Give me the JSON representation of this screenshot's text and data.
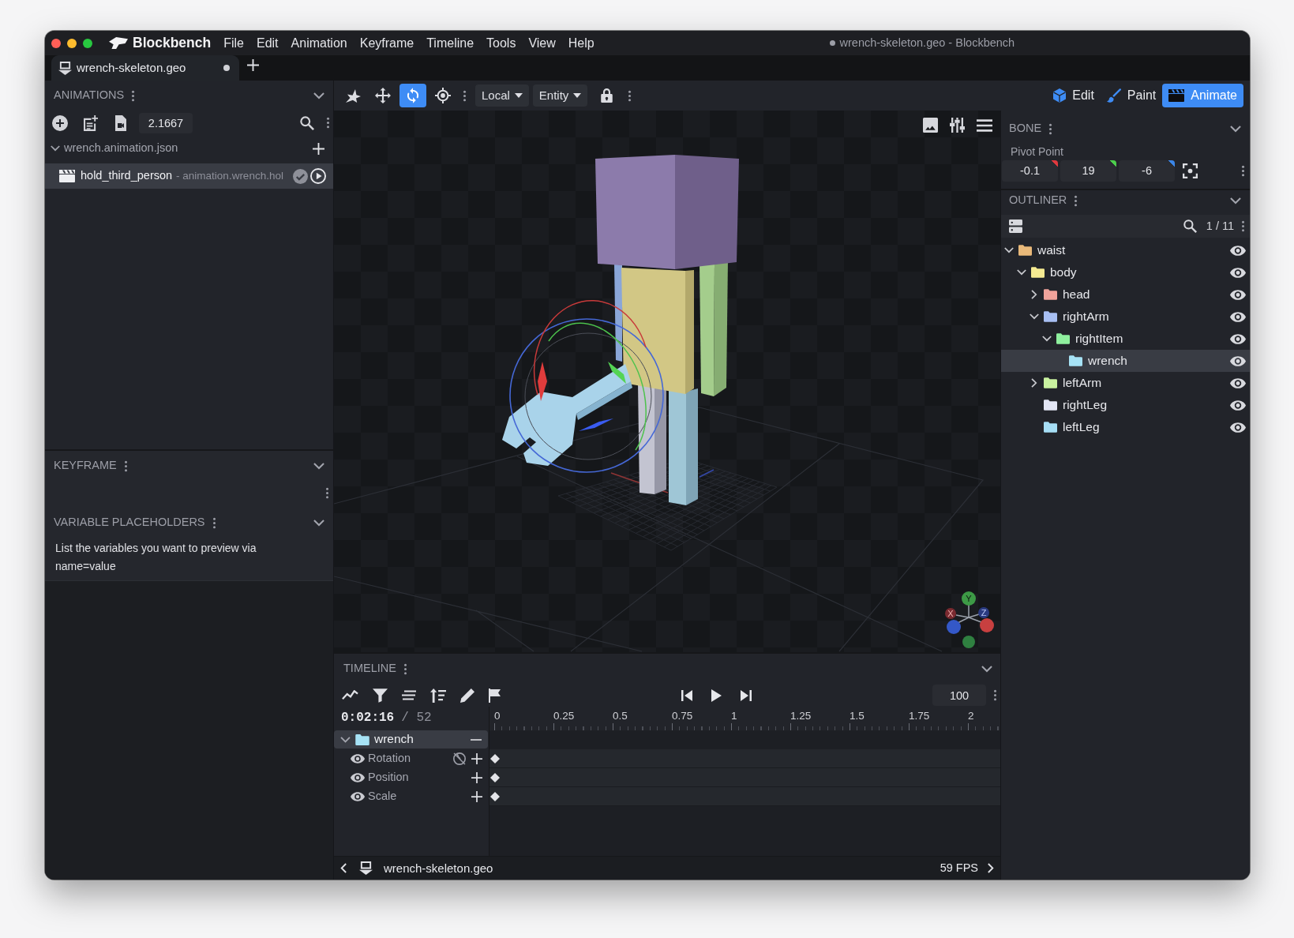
{
  "window": {
    "title": "wrench-skeleton.geo - Blockbench",
    "unsaved": true
  },
  "app_name": "Blockbench",
  "menu": [
    "File",
    "Edit",
    "Animation",
    "Keyframe",
    "Timeline",
    "Tools",
    "View",
    "Help"
  ],
  "tabs": [
    {
      "label": "wrench-skeleton.geo",
      "selected": true,
      "unsaved": true
    }
  ],
  "animations_panel": {
    "title": "ANIMATIONS",
    "value": "2.1667",
    "files": [
      {
        "name": "wrench.animation.json",
        "expanded": true,
        "animations": [
          {
            "name": "hold_third_person",
            "subtitle": "- animation.wrench.hol",
            "selected": true,
            "saved": true,
            "playing": false
          }
        ]
      }
    ]
  },
  "keyframe_panel": {
    "title": "KEYFRAME"
  },
  "variables_panel": {
    "title": "VARIABLE PLACEHOLDERS",
    "hint": "List the variables you want to preview via name=value"
  },
  "toolbar": {
    "tools": [
      {
        "kind": "pose",
        "selected": false
      },
      {
        "kind": "move",
        "selected": false
      },
      {
        "kind": "rotate",
        "selected": true
      },
      {
        "kind": "pivot",
        "selected": false
      }
    ],
    "space": "Local",
    "target": "Entity",
    "locked": true
  },
  "modes": [
    {
      "kind": "edit",
      "label": "Edit",
      "selected": false
    },
    {
      "kind": "paint",
      "label": "Paint",
      "selected": false
    },
    {
      "kind": "animate",
      "label": "Animate",
      "selected": true
    }
  ],
  "viewport": {
    "axis_labels": [
      "X",
      "Y",
      "Z"
    ]
  },
  "bone_panel": {
    "title": "BONE",
    "pivot_label": "Pivot Point",
    "pivot": [
      "-0.1",
      "19",
      "-6"
    ]
  },
  "outliner": {
    "title": "OUTLINER",
    "count": "1 / 11",
    "tree": [
      {
        "name": "waist",
        "color": "#e9b97a",
        "expanded": true,
        "selected": false,
        "visible": true,
        "children": [
          {
            "name": "body",
            "color": "#f5ea92",
            "expanded": true,
            "selected": false,
            "visible": true,
            "children": [
              {
                "name": "head",
                "color": "#f0a39b",
                "expanded": false,
                "selected": false,
                "visible": true
              },
              {
                "name": "rightArm",
                "color": "#a8bff3",
                "expanded": true,
                "selected": false,
                "visible": true,
                "children": [
                  {
                    "name": "rightItem",
                    "color": "#8ff09e",
                    "expanded": true,
                    "selected": false,
                    "visible": true,
                    "children": [
                      {
                        "name": "wrench",
                        "color": "#a6e2f5",
                        "selected": true,
                        "visible": true
                      }
                    ]
                  }
                ]
              },
              {
                "name": "leftArm",
                "color": "#c9f2a0",
                "expanded": false,
                "selected": false,
                "visible": true
              },
              {
                "name": "rightLeg",
                "color": "#e3e6f5",
                "selected": false,
                "visible": true
              },
              {
                "name": "leftLeg",
                "color": "#a6def5",
                "selected": false,
                "visible": true
              }
            ]
          }
        ]
      }
    ]
  },
  "timeline": {
    "title": "TIMELINE",
    "playing": false,
    "zoom": "100",
    "time": "0:02:16",
    "frames": "/ 52",
    "ruler": [
      "0",
      "0.25",
      "0.5",
      "0.75",
      "1",
      "1.25",
      "1.5",
      "1.75",
      "2"
    ],
    "groups": [
      {
        "name": "wrench",
        "expanded": true,
        "selected": true,
        "channels": [
          {
            "name": "Rotation",
            "visible": true,
            "global": false,
            "keyframe": true
          },
          {
            "name": "Position",
            "visible": true,
            "keyframe": true
          },
          {
            "name": "Scale",
            "visible": true,
            "keyframe": true
          }
        ]
      }
    ]
  },
  "status_bar": {
    "file": "wrench-skeleton.geo",
    "fps": "59 FPS"
  }
}
